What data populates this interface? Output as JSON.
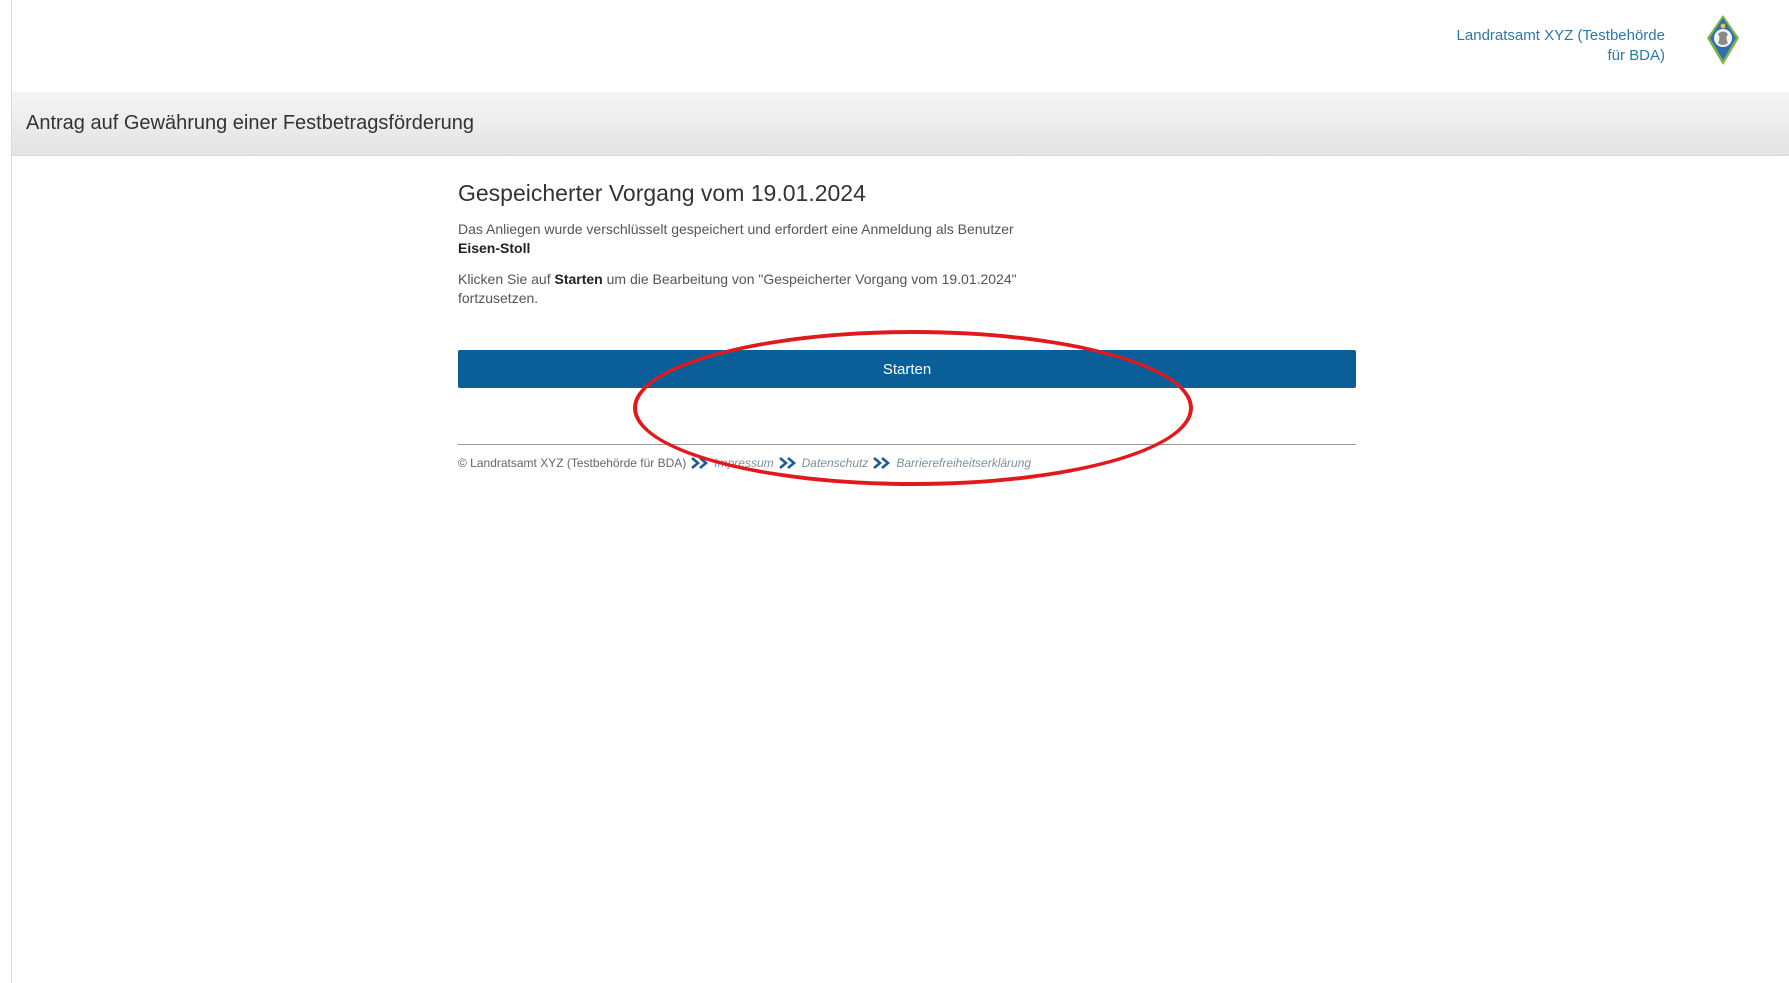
{
  "header": {
    "org_name_line1": "Landratsamt XYZ (Testbehörde",
    "org_name_line2": "für BDA)",
    "logo_icon": "coat-of-arms-icon"
  },
  "titlebar": {
    "title": "Antrag auf Gewährung einer Festbetragsförderung"
  },
  "main": {
    "heading": "Gespeicherter Vorgang vom 19.01.2024",
    "paragraph1_text": "Das Anliegen wurde verschlüsselt gespeichert und erfordert eine Anmeldung als Benutzer",
    "paragraph1_user": "Eisen-Stoll",
    "paragraph2_prefix": "Klicken Sie auf ",
    "paragraph2_bold": "Starten",
    "paragraph2_suffix": " um die Bearbeitung von \"Gespeicherter Vorgang vom 19.01.2024\" fortzusetzen.",
    "start_button_label": "Starten"
  },
  "footer": {
    "copyright": "© Landratsamt XYZ (Testbehörde für BDA)",
    "links": [
      "Impressum",
      "Datenschutz",
      "Barrierefreiheitserklärung"
    ],
    "separator_icon": "double-chevron-right-icon"
  },
  "colors": {
    "accent": "#0b5f99",
    "org_text": "#2e78a8",
    "annotation": "#e2191c"
  }
}
